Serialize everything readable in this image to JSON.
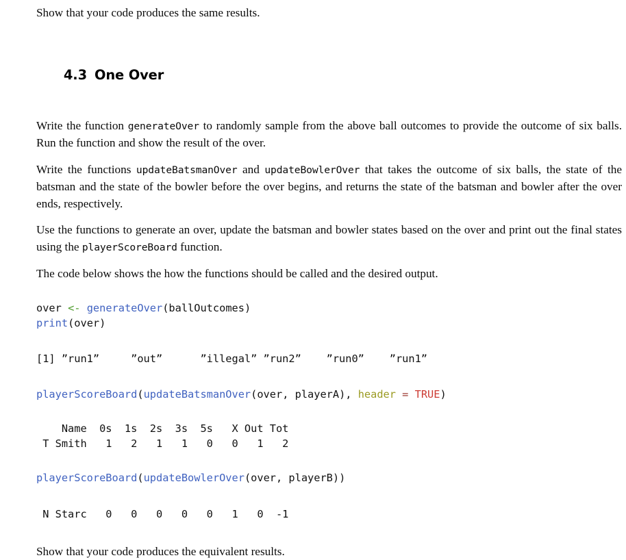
{
  "document": {
    "intro_paragraph": "Show that your code produces the same results.",
    "section": {
      "number": "4.3",
      "title": "One Over"
    },
    "paragraphs": {
      "p1_a": "Write the function ",
      "p1_code": "generateOver",
      "p1_b": " to randomly sample from the above ball outcomes to provide the outcome of six balls. Run the function and show the result of the over.",
      "p2_a": "Write the functions ",
      "p2_code1": "updateBatsmanOver",
      "p2_b": " and ",
      "p2_code2": "updateBowlerOver",
      "p2_c": " that takes the outcome of six balls, the state of the batsman and the state of the bowler before the over begins, and returns the state of the batsman and bowler after the over ends, respectively.",
      "p3_a": "Use the functions to generate an over, update the batsman and bowler states based on the over and print out the final states using the ",
      "p3_code": "playerScoreBoard",
      "p3_b": " function.",
      "p4": "The code below shows the how the functions should be called and the desired output.",
      "p5": "Show that your code produces the equivalent results."
    },
    "code_block_1": {
      "line1_var": "over ",
      "line1_arrow": "<-",
      "line1_fn": " generateOver",
      "line1_args": "(ballOutcomes)",
      "line2_fn": "print",
      "line2_args": "(over)"
    },
    "output_1": "[1] ”run1”     ”out”      ”illegal” ”run2”    ”run0”    ”run1”",
    "code_block_2": {
      "fn_outer": "playerScoreBoard",
      "paren_open": "(",
      "fn_inner": "updateBatsmanOver",
      "inner_args": "(over, playerA), ",
      "arg_name": "header",
      "equals": " = ",
      "const_value": "TRUE",
      "paren_close": ")"
    },
    "output_2": {
      "header": "    Name  0s  1s  2s  3s  5s   X Out Tot",
      "row": " T Smith   1   2   1   1   0   0   1   2"
    },
    "code_block_3": {
      "fn_outer": "playerScoreBoard",
      "paren_open": "(",
      "fn_inner": "updateBowlerOver",
      "inner_args": "(over, playerB))"
    },
    "output_3": " N Starc   0   0   0   0   0   1   0  -1"
  }
}
